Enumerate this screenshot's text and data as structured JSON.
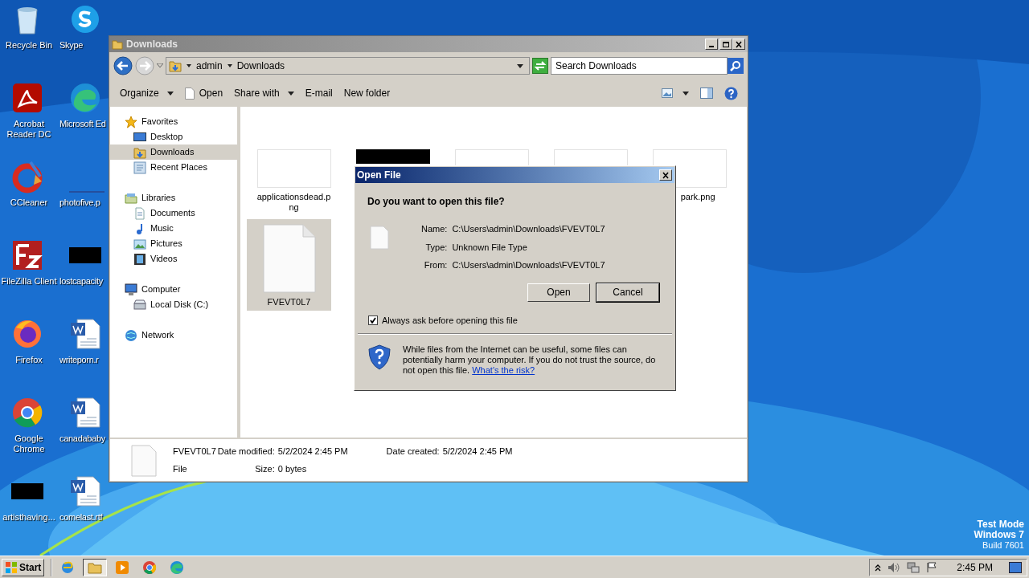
{
  "desktop_icons": [
    {
      "label": "Recycle Bin",
      "kind": "recycle"
    },
    {
      "label": "Skype",
      "kind": "skype"
    },
    {
      "label": "Acrobat Reader DC",
      "kind": "acrobat"
    },
    {
      "label": "Microsoft Ed",
      "kind": "edge"
    },
    {
      "label": "CCleaner",
      "kind": "ccleaner"
    },
    {
      "label": "photofive.p",
      "kind": "blank"
    },
    {
      "label": "FileZilla Client",
      "kind": "filezilla"
    },
    {
      "label": "lostcapacity",
      "kind": "black"
    },
    {
      "label": "Firefox",
      "kind": "firefox"
    },
    {
      "label": "writeporn.r",
      "kind": "word"
    },
    {
      "label": "Google Chrome",
      "kind": "chrome"
    },
    {
      "label": "canadababy",
      "kind": "word"
    },
    {
      "label": "artisthaving...",
      "kind": "black"
    },
    {
      "label": "comelast.rtf",
      "kind": "word"
    }
  ],
  "explorer": {
    "title": "Downloads",
    "breadcrumb": [
      "admin",
      "Downloads"
    ],
    "search": {
      "placeholder": "Search Downloads"
    },
    "toolbar": [
      {
        "label": "Organize",
        "dropdown": true,
        "kind": "text"
      },
      {
        "label": "Open",
        "dropdown": false,
        "kind": "file"
      },
      {
        "label": "Share with",
        "dropdown": true,
        "kind": "text"
      },
      {
        "label": "E-mail",
        "dropdown": false,
        "kind": "text"
      },
      {
        "label": "New folder",
        "dropdown": false,
        "kind": "text"
      }
    ],
    "nav": [
      {
        "label": "Favorites",
        "kind": "star",
        "selected": false,
        "children": [
          {
            "label": "Desktop",
            "kind": "desktop",
            "selected": false
          },
          {
            "label": "Downloads",
            "kind": "folder",
            "selected": true
          },
          {
            "label": "Recent Places",
            "kind": "recent",
            "selected": false
          }
        ]
      },
      {
        "label": "Libraries",
        "kind": "library",
        "selected": false,
        "children": [
          {
            "label": "Documents",
            "kind": "doc",
            "selected": false
          },
          {
            "label": "Music",
            "kind": "music",
            "selected": false
          },
          {
            "label": "Pictures",
            "kind": "picture",
            "selected": false
          },
          {
            "label": "Videos",
            "kind": "video",
            "selected": false
          }
        ]
      },
      {
        "label": "Computer",
        "kind": "computer",
        "selected": false,
        "children": [
          {
            "label": "Local Disk (C:)",
            "kind": "disk",
            "selected": false
          }
        ]
      },
      {
        "label": "Network",
        "kind": "network",
        "selected": false
      }
    ],
    "files": [
      {
        "name": "applicationsdead.png",
        "kind": "white",
        "selected": false
      },
      {
        "kind": "black",
        "selected": false
      },
      {
        "kind": "white",
        "selected": false
      },
      {
        "kind": "white",
        "selected": false
      },
      {
        "name": "park.png",
        "kind": "white",
        "selected": false
      },
      {
        "name": "FVEVT0L7",
        "kind": "file",
        "selected": true
      }
    ],
    "details": {
      "name": "FVEVT0L7",
      "type": "File",
      "fields": [
        {
          "label": "Date modified:",
          "value": "5/2/2024 2:45 PM"
        },
        {
          "label": "Date created:",
          "value": "5/2/2024 2:45 PM"
        },
        {
          "label": "Size:",
          "value": "0 bytes"
        }
      ]
    }
  },
  "dialog": {
    "title": "Open File",
    "question": "Do you want to open this file?",
    "fields": [
      {
        "label": "Name:",
        "value": "C:\\Users\\admin\\Downloads\\FVEVT0L7"
      },
      {
        "label": "Type:",
        "value": "Unknown File Type"
      },
      {
        "label": "From:",
        "value": "C:\\Users\\admin\\Downloads\\FVEVT0L7"
      }
    ],
    "buttons": [
      {
        "label": "Open",
        "default": false
      },
      {
        "label": "Cancel",
        "default": true
      }
    ],
    "checkbox": {
      "label": "Always ask before opening this file",
      "checked": true
    },
    "warning": "While files from the Internet can be useful, some files can potentially harm your computer. If you do not trust the source, do not open this file.",
    "link": "What's the risk?"
  },
  "taskbar": {
    "start": "Start",
    "apps": [
      {
        "kind": "ie",
        "selected": false
      },
      {
        "kind": "explorer",
        "selected": true
      },
      {
        "kind": "media",
        "selected": false
      },
      {
        "kind": "chrome",
        "selected": false
      },
      {
        "kind": "edge",
        "selected": false
      }
    ],
    "clock": "2:45 PM"
  },
  "watermark_text": [
    "Test Mode",
    "Windows 7",
    "Build 7601"
  ]
}
